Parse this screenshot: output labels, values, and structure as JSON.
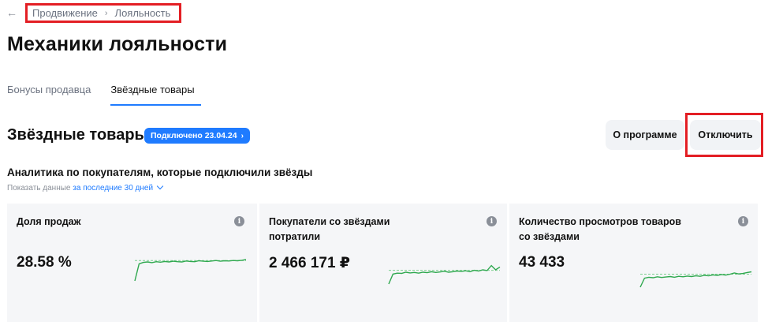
{
  "breadcrumb": {
    "items": [
      "Продвижение",
      "Лояльность"
    ],
    "separator": "›"
  },
  "page_title": "Механики лояльности",
  "tabs": [
    {
      "label": "Бонусы продавца",
      "active": false
    },
    {
      "label": "Звёздные товары",
      "active": true
    }
  ],
  "section": {
    "title": "Звёздные товары",
    "status_badge": "Подключено 23.04.24"
  },
  "buttons": {
    "about": "О программе",
    "disable": "Отключить"
  },
  "analytics": {
    "title": "Аналитика по покупателям, которые подключили звёзды",
    "period_prefix": "Показать данные",
    "period_value": "за последние 30 дней"
  },
  "cards": [
    {
      "label": "Доля продаж",
      "value": "28.58 %",
      "spark": [
        0,
        0.72,
        0.78,
        0.8,
        0.77,
        0.81,
        0.79,
        0.82,
        0.8,
        0.83,
        0.81,
        0.8,
        0.84,
        0.82,
        0.81,
        0.85,
        0.83,
        0.82,
        0.84,
        0.86,
        0.83,
        0.85,
        0.84,
        0.86,
        0.85,
        0.87,
        0.9
      ],
      "baseline": 0.86
    },
    {
      "label": "Покупатели со звёздами потратили",
      "value": "2 466 171 ₽",
      "spark": [
        0,
        0.42,
        0.46,
        0.45,
        0.5,
        0.47,
        0.49,
        0.46,
        0.5,
        0.48,
        0.52,
        0.49,
        0.51,
        0.54,
        0.5,
        0.52,
        0.55,
        0.53,
        0.56,
        0.52,
        0.58,
        0.55,
        0.6,
        0.57,
        0.78,
        0.6,
        0.72
      ],
      "baseline": 0.58
    },
    {
      "label": "Количество просмотров товаров со звёздами",
      "value": "43 433",
      "spark": [
        0,
        0.38,
        0.42,
        0.4,
        0.44,
        0.41,
        0.43,
        0.45,
        0.42,
        0.46,
        0.44,
        0.47,
        0.45,
        0.48,
        0.46,
        0.5,
        0.48,
        0.52,
        0.5,
        0.53,
        0.51,
        0.55,
        0.6,
        0.56,
        0.58,
        0.62,
        0.65
      ],
      "baseline": 0.55
    }
  ],
  "colors": {
    "accent": "#1f7bff",
    "highlight": "#e31e24",
    "spark": "#2fa84f",
    "spark_baseline": "#7ccf8f"
  },
  "icons": {
    "back": "arrow-left-icon",
    "info": "info-icon",
    "chevron": "chevron-right-icon"
  }
}
